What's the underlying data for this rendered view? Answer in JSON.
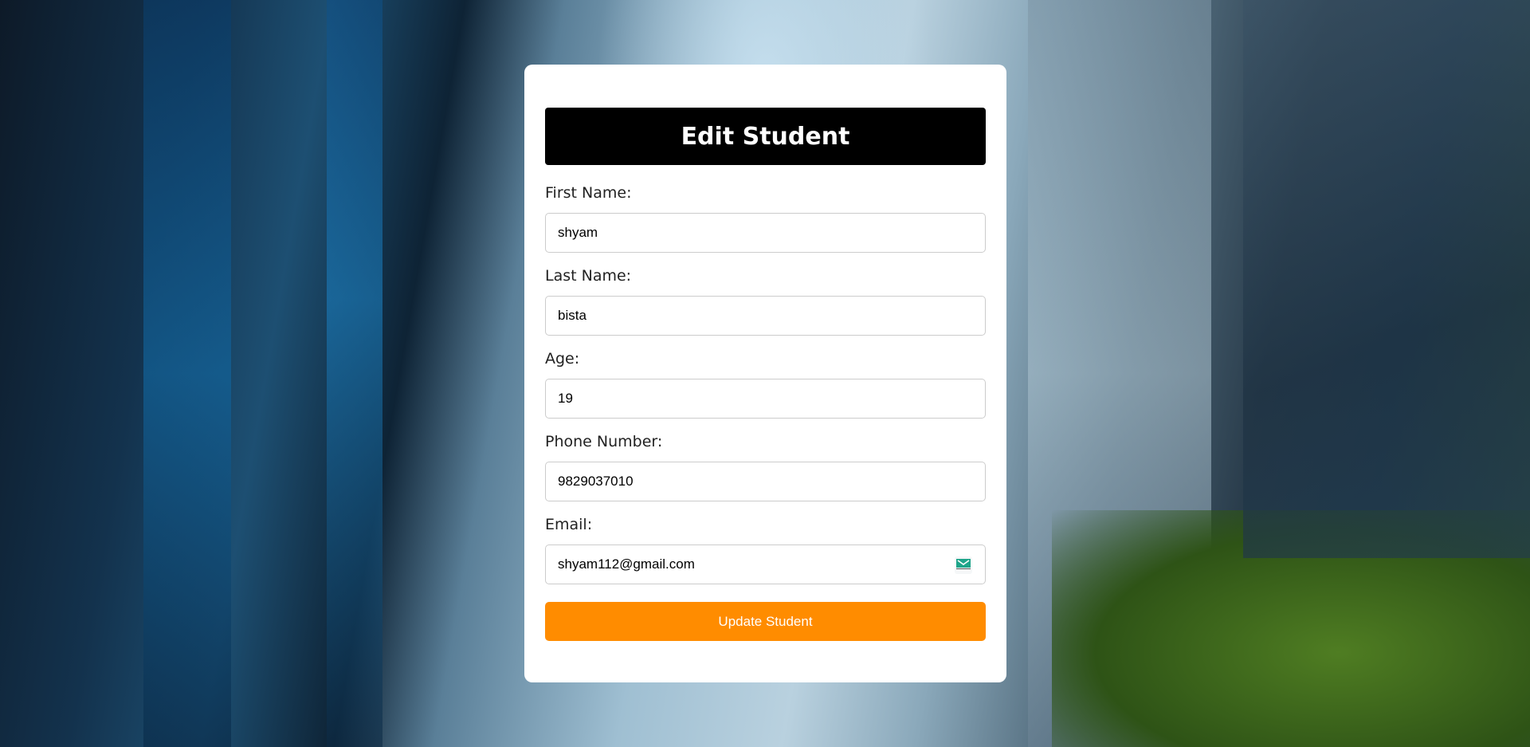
{
  "form": {
    "title": "Edit Student",
    "fields": [
      {
        "label": "First Name:",
        "value": "shyam"
      },
      {
        "label": "Last Name:",
        "value": "bista"
      },
      {
        "label": "Age:",
        "value": "19"
      },
      {
        "label": "Phone Number:",
        "value": "9829037010"
      },
      {
        "label": "Email:",
        "value": "shyam112@gmail.com",
        "icon": "temp-mail-envelope-icon"
      }
    ],
    "submit_label": "Update Student"
  },
  "colors": {
    "header_bg": "#000000",
    "button_bg": "#ff8c00",
    "icon_green": "#1fa58a"
  }
}
